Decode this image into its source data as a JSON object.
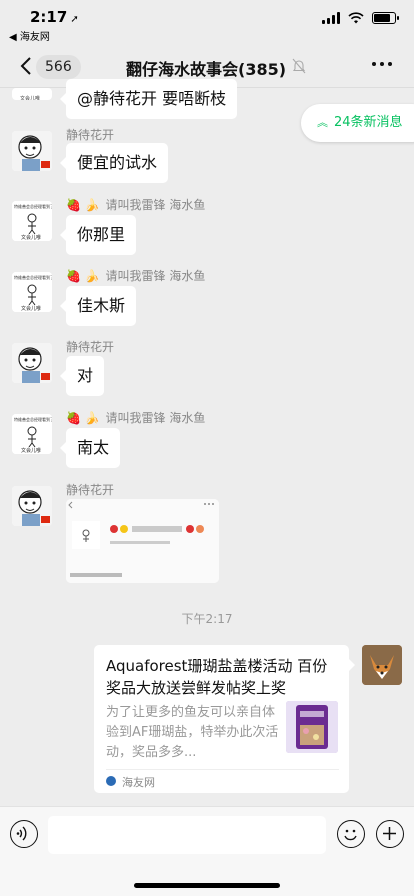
{
  "status_bar": {
    "time": "2:17",
    "back_app": "◀ 海友网",
    "battery_level": 0.8
  },
  "header": {
    "unread_count": "566",
    "title": "翻仔海水故事会(385)"
  },
  "new_messages": {
    "label": "24条新消息"
  },
  "messages": [
    {
      "sender": "",
      "text": "@静待花开 要唔断枝"
    },
    {
      "sender": "静待花开",
      "text": "便宜的试水"
    },
    {
      "sender": "请叫我雷锋 海水鱼",
      "sender_emoji": "🍓 🍌",
      "text": "你那里"
    },
    {
      "sender": "请叫我雷锋 海水鱼",
      "sender_emoji": "🍓 🍌",
      "text": "佳木斯"
    },
    {
      "sender": "静待花开",
      "text": "对"
    },
    {
      "sender": "请叫我雷锋 海水鱼",
      "sender_emoji": "🍓 🍌",
      "text": "南太"
    },
    {
      "sender": "静待花开",
      "text": ""
    }
  ],
  "timestamp": "下午2:17",
  "link_card": {
    "title": "Aquaforest珊瑚盐盖楼活动 百份奖品大放送尝鲜发帖奖上奖",
    "description": "为了让更多的鱼友可以亲自体验到AF珊瑚盐，特举办此次活动，奖品多多...",
    "source": "海友网"
  },
  "icons": [
    "back-chevron-icon",
    "mute-bell-icon",
    "more-icon",
    "voice-icon",
    "emoji-icon",
    "plus-icon"
  ]
}
